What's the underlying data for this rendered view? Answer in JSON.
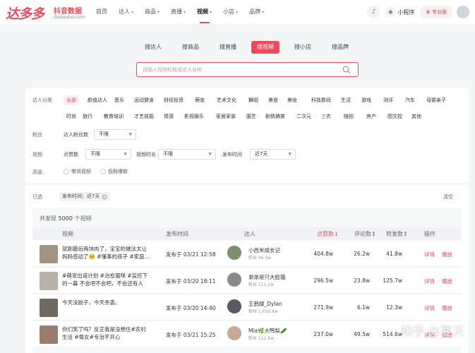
{
  "brand": {
    "name": "达多多",
    "sub": "抖音数据",
    "url": "daduoduo.com",
    "accent": "#e94d5d"
  },
  "nav": [
    {
      "label": "首页",
      "caret": false
    },
    {
      "label": "达人",
      "caret": true
    },
    {
      "label": "商品",
      "caret": true
    },
    {
      "label": "直播",
      "caret": true
    },
    {
      "label": "视频",
      "caret": true,
      "active": true
    },
    {
      "label": "小店",
      "caret": true
    },
    {
      "label": "品牌",
      "caret": true
    }
  ],
  "topbar": {
    "mini_program": "小程序",
    "pro": "专业版"
  },
  "search": {
    "tabs": [
      "搜达人",
      "搜商品",
      "搜直播",
      "搜视频",
      "搜小店",
      "搜品牌"
    ],
    "active_tab": "搜视频",
    "placeholder": "请输入视频标题或达人名称"
  },
  "filters": {
    "category_label": "达人分类",
    "categories_row1": [
      "全部",
      "颜值达人",
      "音乐",
      "运动健身",
      "财经投资",
      "萌宠",
      "艺术文化",
      "舞蹈",
      "美食",
      "美妆",
      "科技数码",
      "生活",
      "游戏",
      "测评",
      "汽车",
      "母婴亲子"
    ],
    "categories_row2": [
      "时尚",
      "旅行",
      "教育培训",
      "才艺技能",
      "情感",
      "影视娱乐",
      "家居家装",
      "園艺",
      "剧情搞笑",
      "二次元",
      "三农",
      "随拍",
      "房产",
      "图文控",
      "其他"
    ],
    "fans_label": "粉丝",
    "fans_sub_label": "达人粉丝数",
    "fans_value": "不限",
    "video_label": "视频",
    "likes_label": "点赞数",
    "likes_value": "不限",
    "duration_label": "视频时长",
    "duration_value": "不限",
    "publish_label": "发布时间",
    "publish_value": "近7天",
    "advanced_label": "高级",
    "adv_opt1": "带货视频",
    "adv_opt2": "低粉爆款",
    "selected_label": "已选",
    "selected_chip": "发布时间：近7天",
    "clear": "清空"
  },
  "results": {
    "count_prefix": "共发现",
    "count": "5000",
    "count_suffix": "个视频",
    "headers": {
      "video": "视频",
      "publish": "发布时间",
      "author": "达人",
      "likes": "点赞数",
      "comments": "评论数",
      "shares": "转发数",
      "ops": "操作"
    },
    "rows": [
      {
        "title": "就刚最后两块肉了，宝宝的做法太让妈妈感动了🥺 #懂事的孩子 #家庭...",
        "date": "发布于 03/21 12:58",
        "author": "小西米成长记",
        "fans": "粉丝 46.0w",
        "likes": "404.8w",
        "comments": "26.2w",
        "shares": "41.8w",
        "thumb": "#a39481",
        "avatar": "#7a8f6a"
      },
      {
        "title": "#萌宠出道计划 #治愈猫咪 #监控下的一幕 不会吧不会吧，不会还有人没...",
        "date": "发布于 03/20 18:11",
        "author": "弟弟是只大脸猫",
        "fans": "粉丝 111.2w",
        "likes": "296.5w",
        "comments": "23.8w",
        "shares": "125.7w",
        "thumb": "#b9b2a8",
        "avatar": "#8a8a8a"
      },
      {
        "title": "今天没胶子，今天杀香。",
        "date": "发布于 03/20 14:40",
        "author": "王鹤棣_Dylan",
        "fans": "粉丝 1,659.8w",
        "likes": "271.9w",
        "comments": "6.1w",
        "shares": "12.3w",
        "thumb": "#706960",
        "avatar": "#5a5a63"
      },
      {
        "title": "你们笑了吗？反正我是没想住#农村生活 #每女#专治不开心",
        "date": "发布于 03/21 15:25",
        "author": "Mia🌿大鸭梨🥒",
        "fans": "粉丝 122.8w",
        "likes": "237.0w",
        "comments": "49.5w",
        "shares": "514.6w",
        "thumb": "#9a7d6a",
        "avatar": "#c8a896"
      }
    ],
    "op_detail": "详情",
    "op_play": "播放"
  },
  "watermark": "知乎 @夏天"
}
